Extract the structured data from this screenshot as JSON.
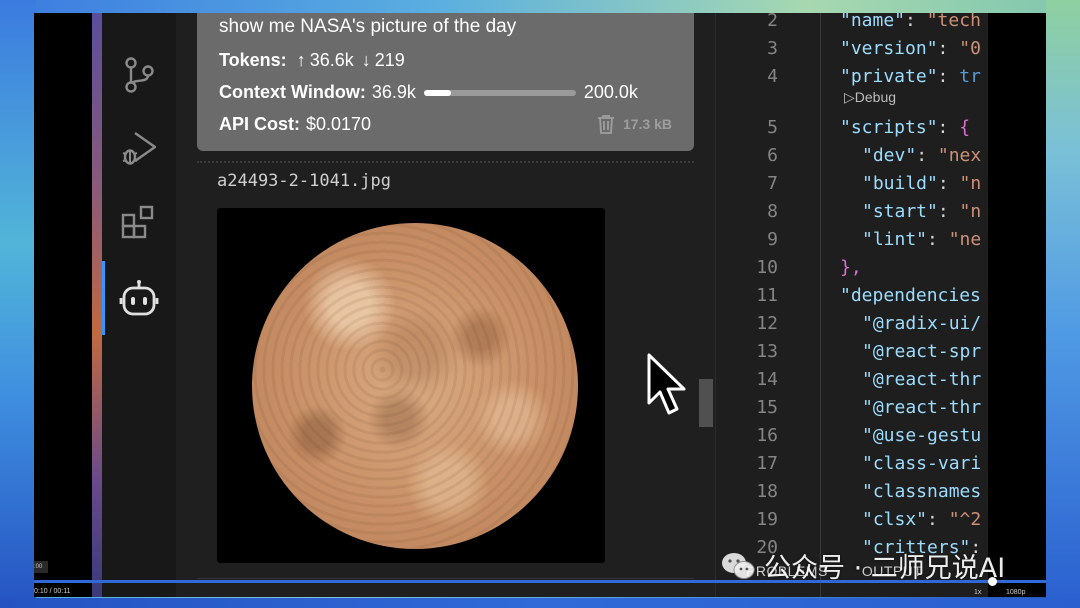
{
  "task": {
    "text": "show me NASA's picture of the day",
    "tokens_label": "Tokens:",
    "tokens_up": "36.6k",
    "tokens_down": "219",
    "context_label": "Context Window:",
    "context_used": "36.9k",
    "context_max": "200.0k",
    "context_fraction": 0.18,
    "cost_label": "API Cost:",
    "cost_value": "$0.0170",
    "size": "17.3 kB"
  },
  "attachment": {
    "filename": "a24493-2-1041.jpg"
  },
  "editor": {
    "codelens": "Debug",
    "lines": [
      {
        "n": "2",
        "key": "\"name\"",
        "sep": ": ",
        "val": "\"tech",
        "val_class": "str",
        "indent": 1
      },
      {
        "n": "3",
        "key": "\"version\"",
        "sep": ": ",
        "val": "\"0",
        "val_class": "str",
        "indent": 1
      },
      {
        "n": "4",
        "key": "\"private\"",
        "sep": ": ",
        "val": "tr",
        "val_class": "bool",
        "indent": 1
      },
      {
        "n": "5",
        "key": "\"scripts\"",
        "sep": ": ",
        "val": "{",
        "val_class": "brace",
        "indent": 1
      },
      {
        "n": "6",
        "key": "\"dev\"",
        "sep": ": ",
        "val": "\"nex",
        "val_class": "str",
        "indent": 2
      },
      {
        "n": "7",
        "key": "\"build\"",
        "sep": ": ",
        "val": "\"n",
        "val_class": "str",
        "indent": 2
      },
      {
        "n": "8",
        "key": "\"start\"",
        "sep": ": ",
        "val": "\"n",
        "val_class": "str",
        "indent": 2
      },
      {
        "n": "9",
        "key": "\"lint\"",
        "sep": ": ",
        "val": "\"ne",
        "val_class": "str",
        "indent": 2
      },
      {
        "n": "10",
        "key": "",
        "sep": "",
        "val": "},",
        "val_class": "brace",
        "indent": 1
      },
      {
        "n": "11",
        "key": "\"dependencies",
        "sep": "",
        "val": "",
        "val_class": "str",
        "indent": 1
      },
      {
        "n": "12",
        "key": "\"@radix-ui/",
        "sep": "",
        "val": "",
        "val_class": "str",
        "indent": 2
      },
      {
        "n": "13",
        "key": "\"@react-spr",
        "sep": "",
        "val": "",
        "val_class": "str",
        "indent": 2
      },
      {
        "n": "14",
        "key": "\"@react-thr",
        "sep": "",
        "val": "",
        "val_class": "str",
        "indent": 2
      },
      {
        "n": "15",
        "key": "\"@react-thr",
        "sep": "",
        "val": "",
        "val_class": "str",
        "indent": 2
      },
      {
        "n": "16",
        "key": "\"@use-gestu",
        "sep": "",
        "val": "",
        "val_class": "str",
        "indent": 2
      },
      {
        "n": "17",
        "key": "\"class-vari",
        "sep": "",
        "val": "",
        "val_class": "str",
        "indent": 2
      },
      {
        "n": "18",
        "key": "\"classnames",
        "sep": "",
        "val": "",
        "val_class": "str",
        "indent": 2
      },
      {
        "n": "19",
        "key": "\"clsx\"",
        "sep": ": ",
        "val": "\"^2",
        "val_class": "str",
        "indent": 2
      },
      {
        "n": "20",
        "key": "\"critters\"",
        "sep": ":",
        "val": "",
        "val_class": "str",
        "indent": 2
      }
    ]
  },
  "panel": {
    "problems": "PROBLEMS",
    "output": "OUTPUT"
  },
  "watermark": "公众号 · 二师兄说AI",
  "player": {
    "time": "0:10 / 00:11",
    "badge": ":00",
    "speed": "1x",
    "quality": "1080p"
  },
  "colors": {
    "accent": "#3794ff",
    "card": "#6b6b6b",
    "progress": "#2f6ad8"
  }
}
